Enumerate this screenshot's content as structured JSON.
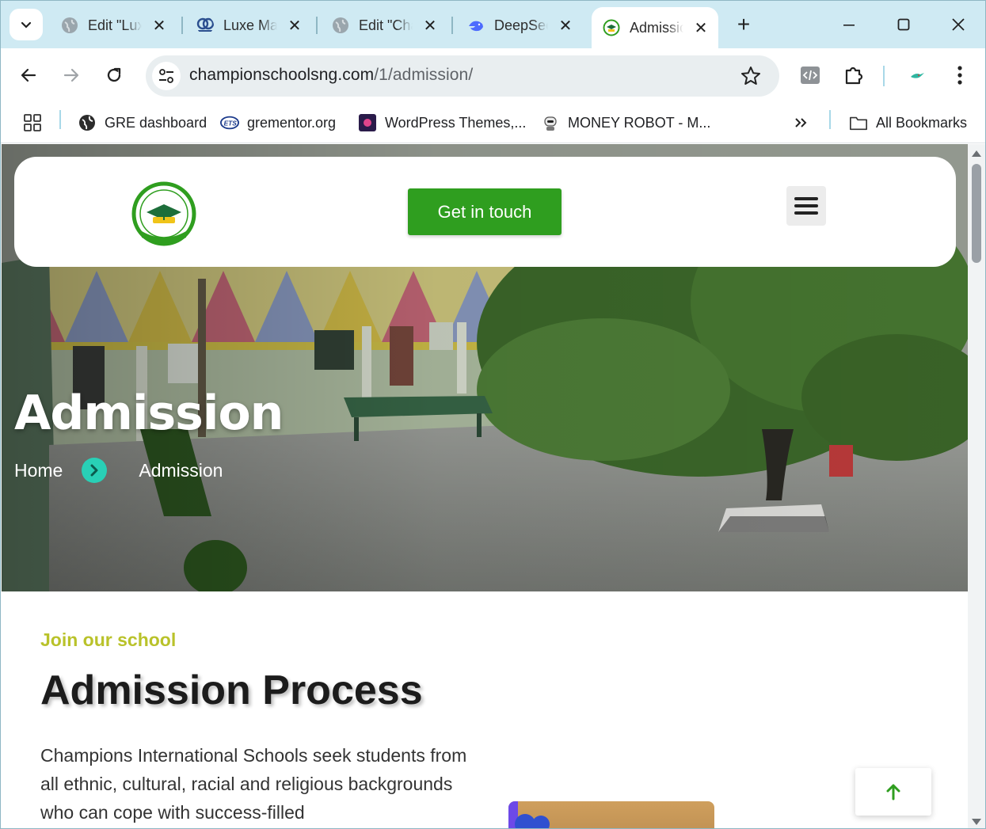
{
  "browser": {
    "tabs": [
      {
        "title": "Edit \"Luxe",
        "favicon": "globe-icon"
      },
      {
        "title": "Luxe Manor",
        "favicon": "luxe-logo-icon"
      },
      {
        "title": "Edit \"Champions",
        "favicon": "globe-icon"
      },
      {
        "title": "DeepSeek",
        "favicon": "deepseek-whale-icon"
      },
      {
        "title": "Admission",
        "favicon": "champions-logo-icon",
        "active": true
      }
    ],
    "address": {
      "host": "championschoolsng.com",
      "path": "/1/admission/"
    },
    "bookmarks": [
      {
        "label": "GRE dashboard",
        "icon": "globe-icon"
      },
      {
        "label": "grementor.org",
        "icon": "ets-icon"
      },
      {
        "label": "WordPress Themes,...",
        "icon": "themeforest-icon"
      },
      {
        "label": "MONEY ROBOT - M...",
        "icon": "robot-icon"
      }
    ],
    "all_bookmarks": "All Bookmarks"
  },
  "page": {
    "header": {
      "cta": "Get in touch"
    },
    "hero": {
      "title": "Admission",
      "breadcrumb": {
        "home": "Home",
        "current": "Admission"
      }
    },
    "section": {
      "eyebrow": "Join our school",
      "title": "Admission Process",
      "body": "Champions International Schools seek students from all ethnic, cultural, racial and religious backgrounds who can cope with success-filled"
    }
  },
  "colors": {
    "cta_green": "#2f9e1f",
    "breadcrumb_accent": "#29d0b6",
    "eyebrow_olive": "#b9c22a",
    "tabstrip": "#cfeaf3"
  }
}
